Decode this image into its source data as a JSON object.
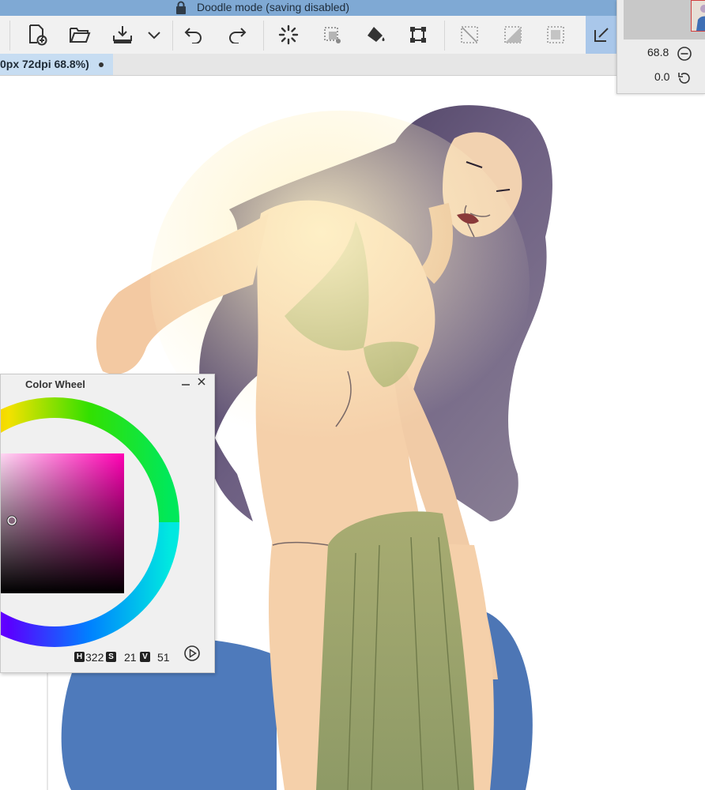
{
  "window": {
    "title": "Doodle mode (saving disabled)",
    "lock_icon": "lock-icon"
  },
  "toolbar": {
    "buttons": [
      {
        "name": "new-document",
        "icon": "new-document-icon"
      },
      {
        "name": "open",
        "icon": "folder-open-icon"
      },
      {
        "name": "save",
        "icon": "download-tray-icon"
      },
      {
        "name": "more",
        "icon": "chevron-down-icon"
      },
      {
        "name": "undo",
        "icon": "undo-icon"
      },
      {
        "name": "redo",
        "icon": "redo-icon"
      },
      {
        "name": "loading",
        "icon": "spinner-icon"
      },
      {
        "name": "selection",
        "icon": "selection-dots-icon"
      },
      {
        "name": "fill",
        "icon": "paint-bucket-icon"
      },
      {
        "name": "transform",
        "icon": "transform-icon"
      },
      {
        "name": "deselect",
        "icon": "deselect-icon"
      },
      {
        "name": "invert-selection",
        "icon": "invert-selection-icon"
      },
      {
        "name": "select-all",
        "icon": "select-all-icon"
      },
      {
        "name": "pen-tool",
        "icon": "pen-corner-icon"
      }
    ]
  },
  "document_tab": {
    "label": "0px 72dpi 68.8%)"
  },
  "navigator": {
    "zoom_value": "68.8",
    "zoom_out_icon": "minus-circle-icon",
    "rotation_value": "0.0",
    "rotate_icon": "rotate-ccw-icon"
  },
  "color_wheel": {
    "title": "Color Wheel",
    "minimize_icon": "minimize-icon",
    "close_icon": "close-icon",
    "h_label": "H",
    "h_value": "322",
    "s_label": "S",
    "s_value": "21",
    "v_label": "V",
    "v_value": "51",
    "mode_icon": "play-circle-icon",
    "hue_color": "#ff00b3"
  },
  "colors": {
    "titlebar_bg": "#7fa9d4",
    "toolbar_bg": "#f1f1f1",
    "active_tool_bg": "#a9c7ea",
    "hair": "#4a3d5c",
    "skin": "#f5d0aa",
    "cloth": "#a7ad72",
    "blue_shape": "#3f6fb5"
  }
}
